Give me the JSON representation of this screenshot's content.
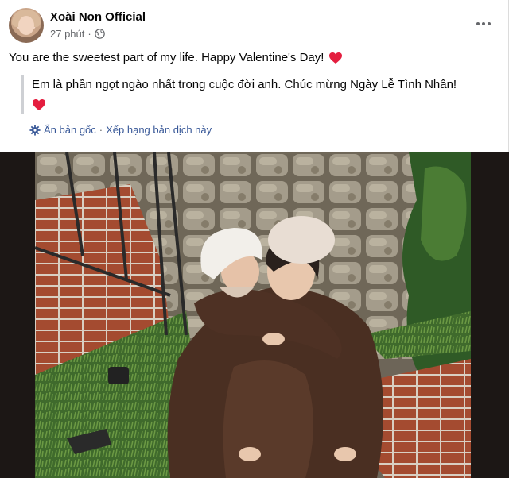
{
  "post": {
    "author": "Xoài Non Official",
    "time": "27 phút",
    "dot": "·",
    "audience_icon": "globe-icon",
    "more_icon": "more-horizontal-icon",
    "caption": "You are the sweetest part of my life. Happy Valentine's Day!",
    "caption_emoji": "red-heart-icon",
    "translation": {
      "text": "Em là phần ngọt ngào nhất trong cuộc đời anh. Chúc mừng Ngày Lễ Tình Nhân!",
      "emoji": "red-heart-icon",
      "show_original": "Ẩn bản gốc",
      "separator": "·",
      "rate_translation": "Xếp hạng bản dịch này",
      "settings_icon": "gear-icon"
    },
    "image": "couple-photo"
  },
  "colors": {
    "text_primary": "#050505",
    "text_secondary": "#65676b",
    "link": "#385898",
    "heart": "#e41e3f",
    "photo_border": "#1c1715"
  }
}
